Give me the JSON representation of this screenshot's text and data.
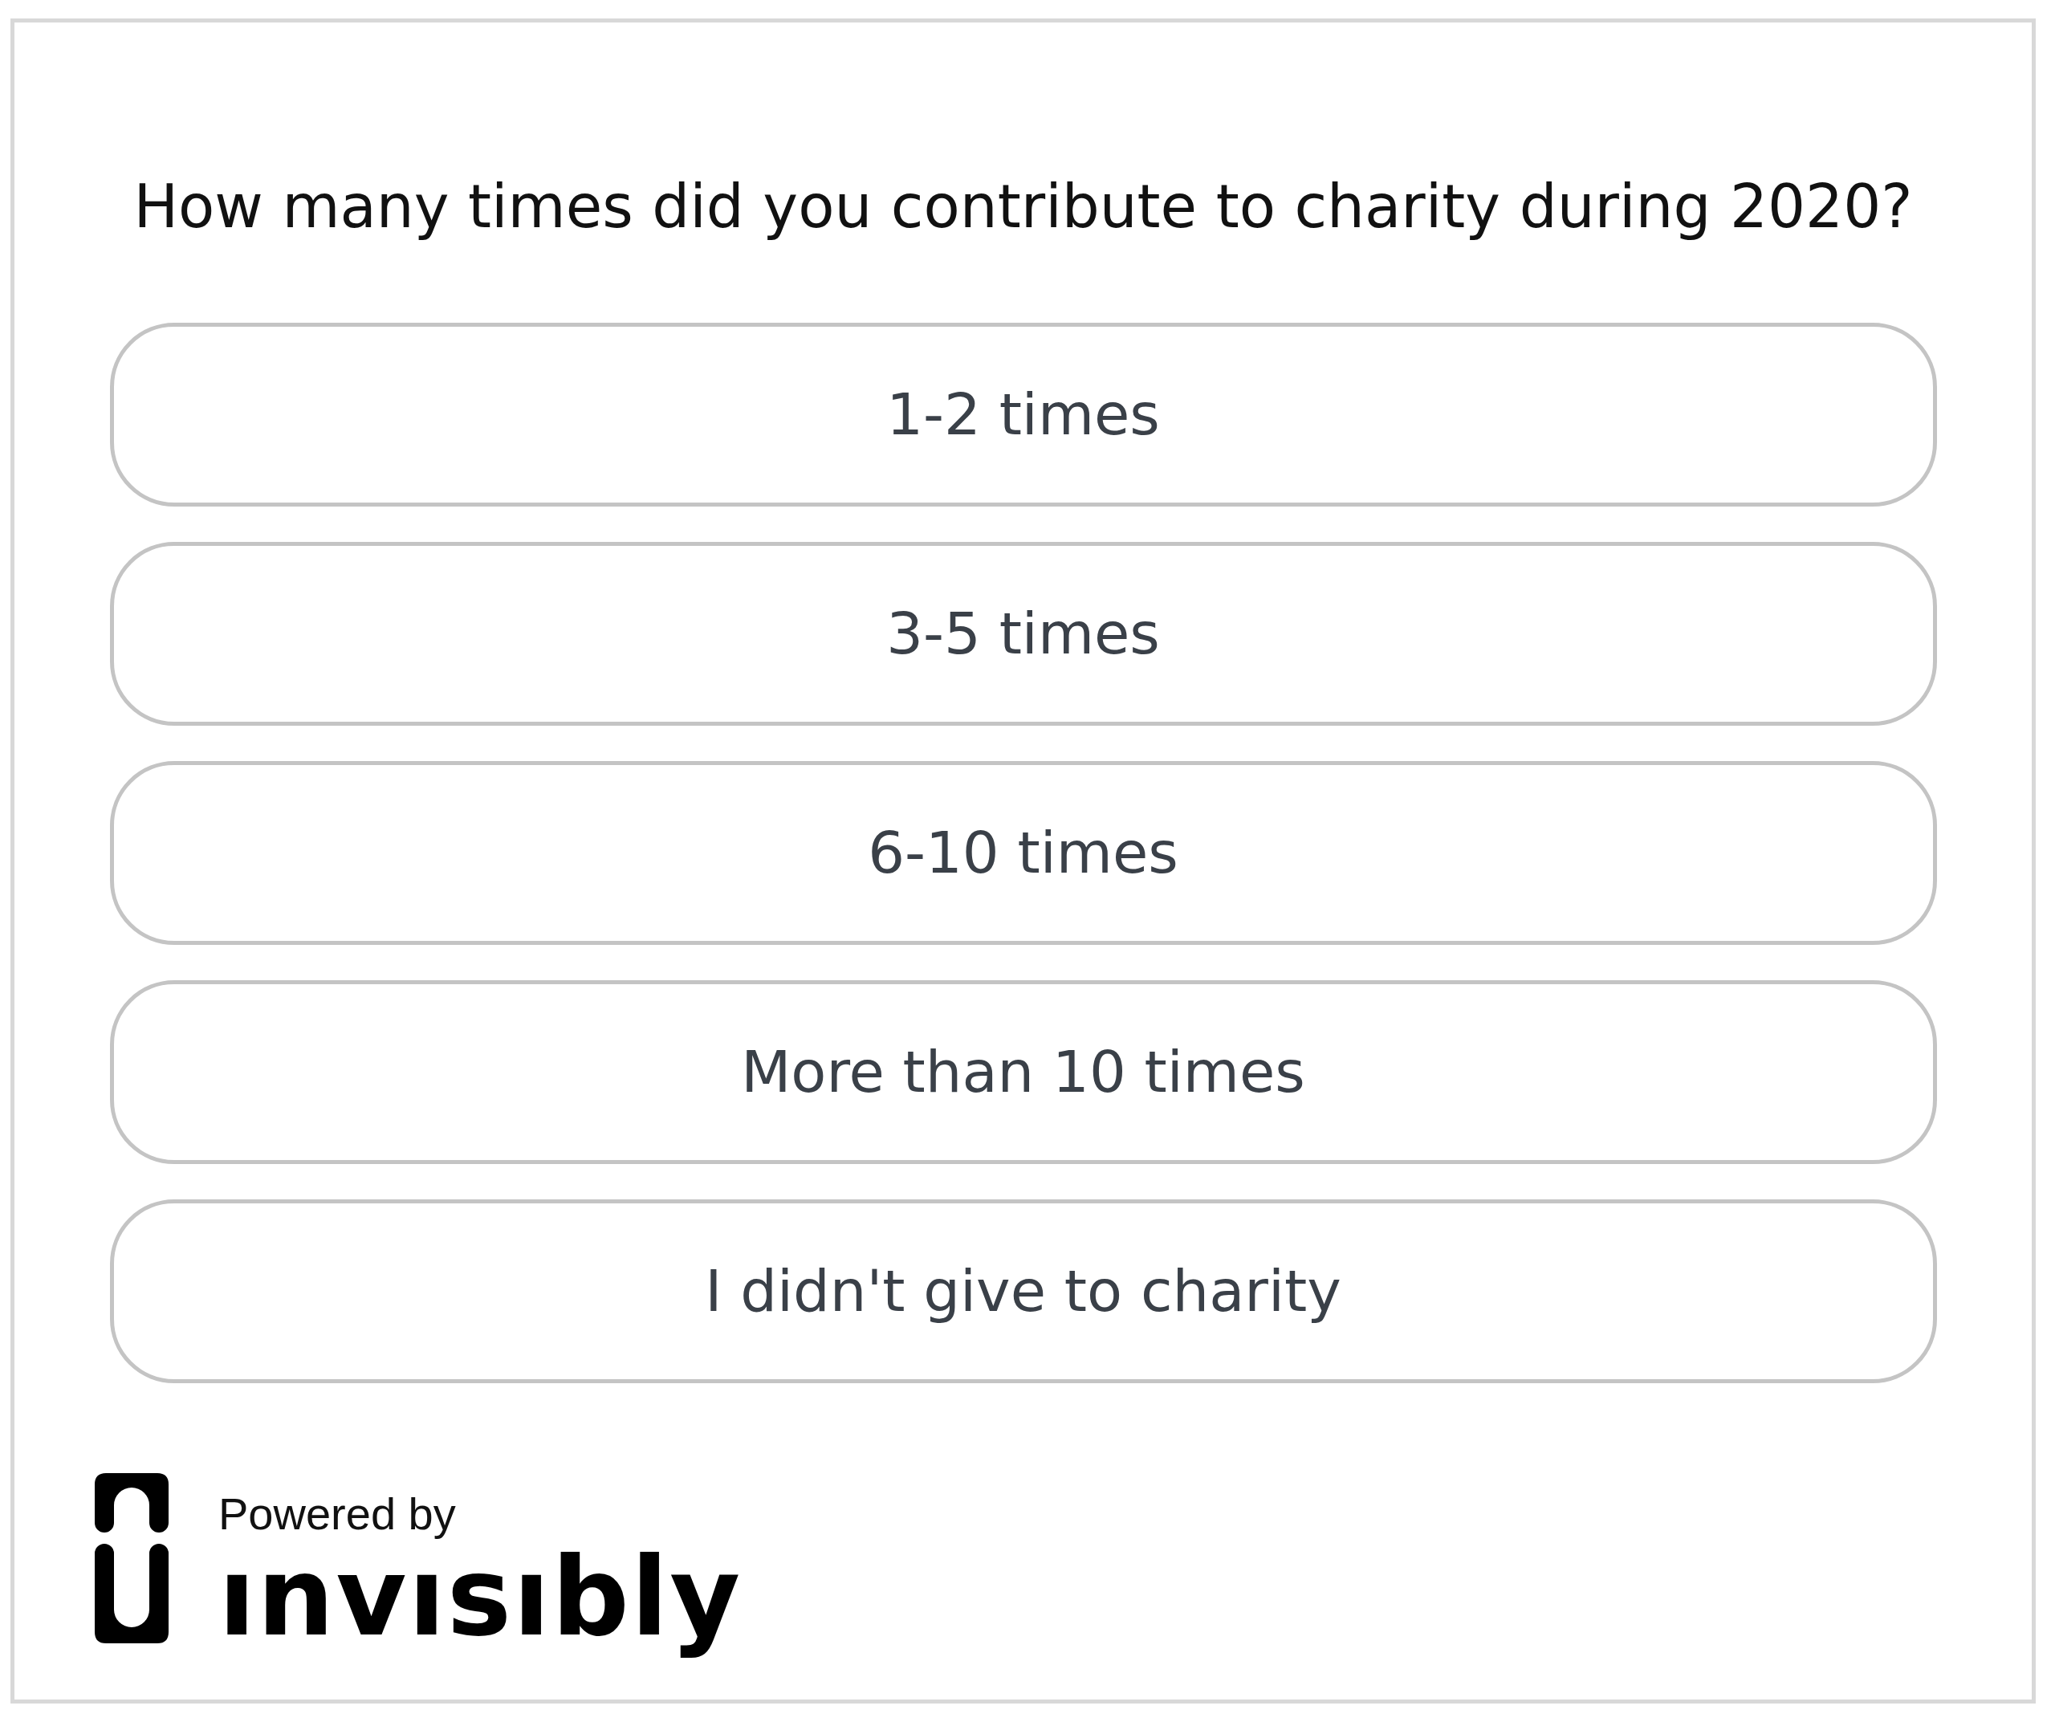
{
  "question": "How many times did you contribute to charity during 2020?",
  "options": [
    {
      "label": "1-2 times"
    },
    {
      "label": "3-5 times"
    },
    {
      "label": "6-10 times"
    },
    {
      "label": "More than 10 times"
    },
    {
      "label": "I didn't give to charity"
    }
  ],
  "footer": {
    "powered_by": "Powered by",
    "brand": "ınvısıbly"
  }
}
